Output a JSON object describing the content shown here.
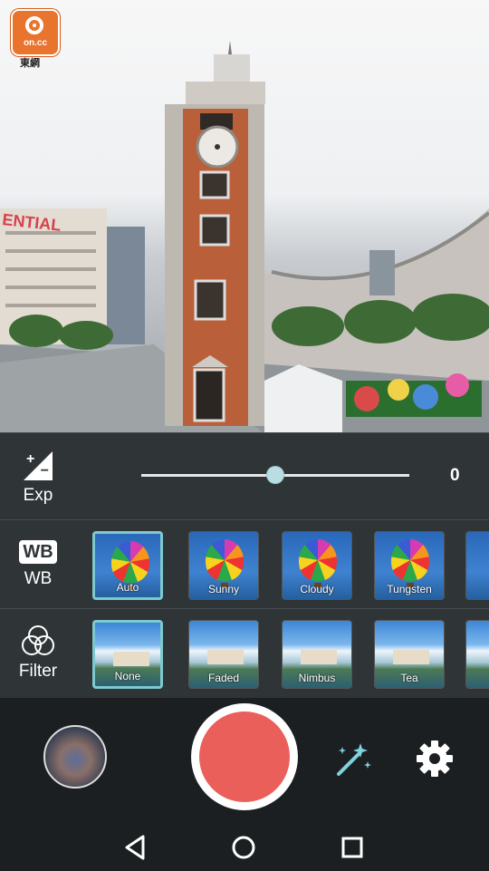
{
  "watermark": {
    "brand_text": "on.cc",
    "sub_text": "東網"
  },
  "preview": {
    "sign_text": "ENTIAL"
  },
  "exposure": {
    "label": "Exp",
    "value": "0",
    "level": 0.5,
    "icon": "exposure-icon"
  },
  "white_balance": {
    "badge": "WB",
    "label": "WB",
    "options": [
      {
        "label": "Auto",
        "selected": true
      },
      {
        "label": "Sunny",
        "selected": false
      },
      {
        "label": "Cloudy",
        "selected": false
      },
      {
        "label": "Tungsten",
        "selected": false
      }
    ]
  },
  "filter": {
    "label": "Filter",
    "options": [
      {
        "label": "None",
        "selected": true
      },
      {
        "label": "Faded",
        "selected": false
      },
      {
        "label": "Nimbus",
        "selected": false
      },
      {
        "label": "Tea",
        "selected": false
      }
    ]
  },
  "bottom_bar": {
    "gallery_icon": "gallery-thumbnail-icon",
    "record_icon": "record-button-icon",
    "effects_icon": "magic-wand-icon",
    "settings_icon": "gear-icon"
  },
  "navbar": {
    "back": "back-triangle-icon",
    "home": "home-circle-icon",
    "recents": "recents-square-icon"
  },
  "colors": {
    "accent": "#7cc9cf",
    "record": "#ea5f5a",
    "panel": "#2f3437",
    "bar": "#1c1f21"
  }
}
